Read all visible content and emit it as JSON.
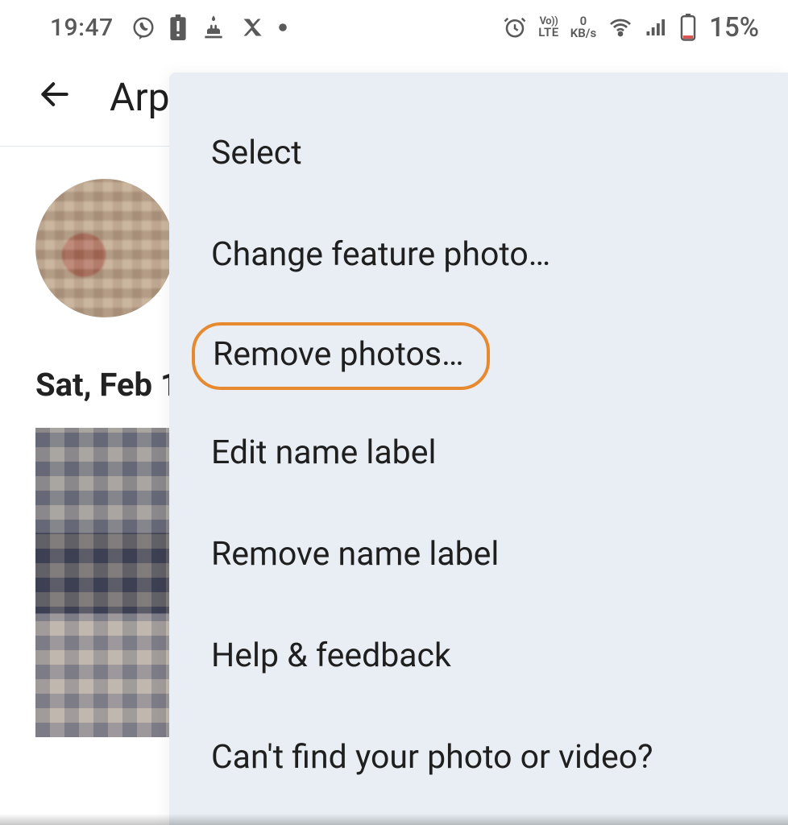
{
  "status_bar": {
    "time": "19:47",
    "net_rate_top": "0",
    "net_rate_bottom": "KB/s",
    "battery_pct": "15%"
  },
  "header": {
    "title_partial": "Arp"
  },
  "content": {
    "date_label": "Sat, Feb 1"
  },
  "menu": {
    "items": [
      {
        "label": "Select"
      },
      {
        "label": "Change feature photo…"
      },
      {
        "label": "Remove photos…"
      },
      {
        "label": "Edit name label"
      },
      {
        "label": "Remove name label"
      },
      {
        "label": "Help & feedback"
      },
      {
        "label": "Can't find your photo or video?"
      }
    ]
  },
  "colors": {
    "menu_bg": "#e8eef4",
    "highlight_border": "#e78a2f"
  }
}
